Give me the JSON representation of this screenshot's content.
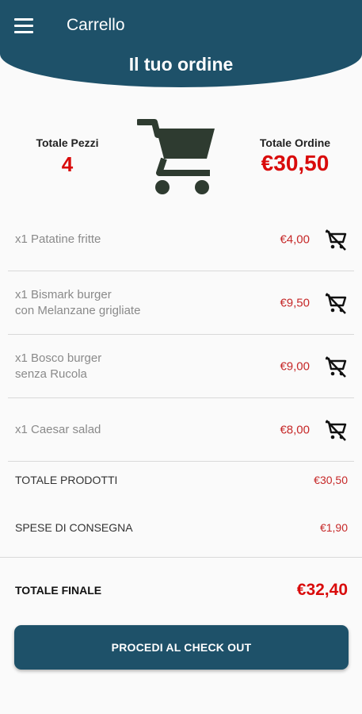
{
  "header": {
    "menu_icon": "menu-icon",
    "app_title": "Carrello",
    "page_title": "Il tuo ordine",
    "color": "#1e5169"
  },
  "summary": {
    "pieces_label": "Totale Pezzi",
    "pieces_value": "4",
    "order_label": "Totale Ordine",
    "order_value": "€30,50",
    "cart_icon": "shopping-cart-icon"
  },
  "items": [
    {
      "name": "x1 Patatine fritte",
      "price": "€4,00",
      "remove_icon": "remove-from-cart-icon"
    },
    {
      "name": "x1 Bismark burger\ncon Melanzane grigliate",
      "price": "€9,50",
      "remove_icon": "remove-from-cart-icon"
    },
    {
      "name": "x1 Bosco burger\nsenza Rucola",
      "price": "€9,00",
      "remove_icon": "remove-from-cart-icon"
    },
    {
      "name": "x1 Caesar salad",
      "price": "€8,00",
      "remove_icon": "remove-from-cart-icon"
    }
  ],
  "totals": {
    "products_label": "TOTALE PRODOTTI",
    "products_value": "€30,50",
    "delivery_label": "SPESE DI CONSEGNA",
    "delivery_value": "€1,90",
    "final_label": "TOTALE FINALE",
    "final_value": "€32,40"
  },
  "checkout": {
    "label": "PROCEDI AL CHECK OUT"
  },
  "colors": {
    "accent": "#1e5169",
    "price": "#d90b0b",
    "background": "#fafafa"
  }
}
